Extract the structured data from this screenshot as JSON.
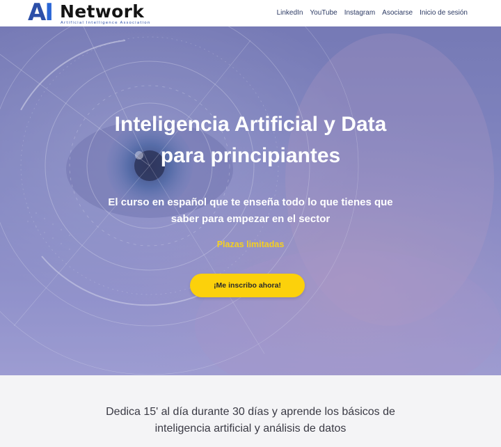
{
  "header": {
    "logo": {
      "mark": "AI",
      "name": "Network",
      "tagline": "Artificial Intelligence Association"
    },
    "nav": [
      "LinkedIn",
      "YouTube",
      "Instagram",
      "Asociarse",
      "Inicio de sesión"
    ]
  },
  "hero": {
    "title_line1": "Inteligencia Artificial y Data",
    "title_line2": "para principiantes",
    "subtitle_line1": "El curso en español que te enseña todo lo que tienes que",
    "subtitle_line2": "saber para empezar en el sector",
    "limited": "Plazas limitadas",
    "cta": "¡Me inscribo ahora!"
  },
  "section": {
    "line1": "Dedica 15' al día durante 30 días y aprende los básicos de",
    "line2": "inteligencia artificial y análisis de datos"
  },
  "colors": {
    "hero_overlay": "#8589c2",
    "cta_yellow": "#fcd10b",
    "limited_yellow": "#f5d020",
    "nav_text": "#2c3a63"
  }
}
